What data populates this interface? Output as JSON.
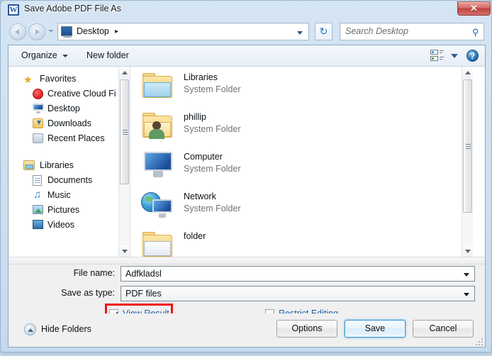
{
  "window": {
    "title": "Save Adobe PDF File As",
    "app_icon": "word-icon",
    "app_icon_letter": "W",
    "close_label": "✕"
  },
  "navigation": {
    "back_icon": "back-arrow-icon",
    "forward_icon": "forward-arrow-icon",
    "history_icon": "history-dropdown-icon",
    "address": {
      "icon": "desktop-icon",
      "crumb": "Desktop",
      "separator": "▸",
      "dropdown_icon": "chevron-down-icon"
    },
    "refresh_icon": "↻",
    "search": {
      "placeholder": "Search Desktop",
      "icon": "search-icon"
    }
  },
  "toolbar": {
    "organize_label": "Organize",
    "organize_caret": "chevron-down-icon",
    "new_folder_label": "New folder",
    "view_icon": "view-mode-icon",
    "view_caret": "chevron-down-icon",
    "help_label": "?"
  },
  "sidebar": {
    "groups": [
      {
        "header": "Favorites",
        "header_icon": "star-icon",
        "items": [
          {
            "label": "Creative Cloud Fi",
            "icon": "creative-cloud-icon"
          },
          {
            "label": "Desktop",
            "icon": "desktop-icon"
          },
          {
            "label": "Downloads",
            "icon": "downloads-icon"
          },
          {
            "label": "Recent Places",
            "icon": "recent-places-icon"
          }
        ]
      },
      {
        "header": "Libraries",
        "header_icon": "libraries-icon",
        "items": [
          {
            "label": "Documents",
            "icon": "documents-icon"
          },
          {
            "label": "Music",
            "icon": "music-icon"
          },
          {
            "label": "Pictures",
            "icon": "pictures-icon"
          },
          {
            "label": "Videos",
            "icon": "videos-icon"
          }
        ]
      }
    ],
    "scrollbar": {
      "up_icon": "scroll-up-icon",
      "down_icon": "scroll-down-icon"
    }
  },
  "file_list": {
    "items": [
      {
        "name": "Libraries",
        "subtitle": "System Folder",
        "icon": "libraries-folder-icon"
      },
      {
        "name": "phillip",
        "subtitle": "System Folder",
        "icon": "user-folder-icon"
      },
      {
        "name": "Computer",
        "subtitle": "System Folder",
        "icon": "computer-icon"
      },
      {
        "name": "Network",
        "subtitle": "System Folder",
        "icon": "network-icon"
      },
      {
        "name": "folder",
        "subtitle": "",
        "icon": "folder-icon"
      }
    ],
    "scrollbar": {
      "up_icon": "scroll-up-icon",
      "down_icon": "scroll-down-icon"
    }
  },
  "form": {
    "file_name_label": "File name:",
    "file_name_value": "Adfkladsl",
    "save_as_type_label": "Save as type:",
    "save_as_type_value": "PDF files",
    "view_result": {
      "label": "View Result",
      "checked": true,
      "highlight_color": "#f21010"
    },
    "restrict_editing": {
      "label": "Restrict Editing",
      "checked": false
    },
    "link_color": "#1b5fa8"
  },
  "footer": {
    "hide_folders_label": "Hide Folders",
    "hide_folders_icon": "collapse-up-icon",
    "options_label": "Options",
    "save_label": "Save",
    "cancel_label": "Cancel"
  }
}
